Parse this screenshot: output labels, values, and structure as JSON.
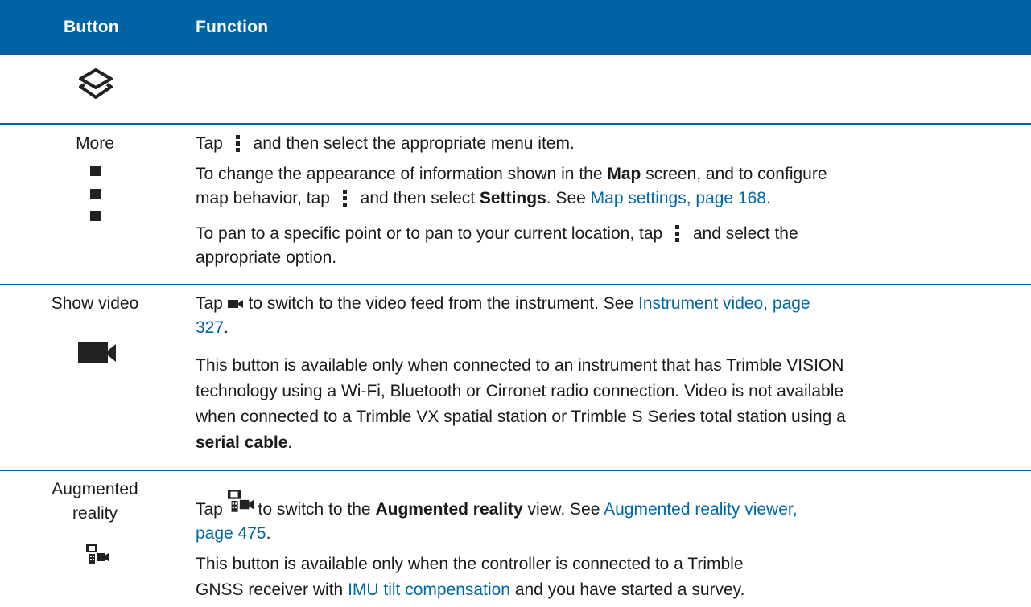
{
  "header": {
    "col_button": "Button",
    "col_function": "Function"
  },
  "icons": {
    "layers": "layers-icon",
    "more": "more-vertical-icon",
    "video": "video-camera-icon",
    "ar": "augmented-reality-icon"
  },
  "rows": {
    "more": {
      "label": "More",
      "p1_a": "Tap",
      "p1_b": "and then select the appropriate menu item.",
      "p2_a": "To change the appearance of information shown in the",
      "p2_map": "Map",
      "p2_b": "screen, and to configure",
      "p2_c": "map behavior, tap",
      "p2_d": "and then select",
      "p2_settings": "Settings",
      "p2_see": ". See",
      "p2_link": "Map settings, page 168",
      "p2_end": ".",
      "p3_a": "To pan to a specific point or to pan to your current location, tap",
      "p3_b": "and select the",
      "p3_c": "appropriate option."
    },
    "video": {
      "label": "Show video",
      "p1_a": "Tap",
      "p1_b": "to switch to the video feed from the instrument. See",
      "p1_link_a": "Instrument video, page",
      "p1_link_b": "327",
      "p1_end": ".",
      "p2_l1": "This button is available only when connected to an instrument that has Trimble VISION",
      "p2_l2": "technology using a Wi-Fi, Bluetooth or Cirronet radio connection. Video is not available",
      "p2_l3": "when connected to a Trimble VX spatial station or Trimble S Series total station using a",
      "p2_bold": "serial cable",
      "p2_end": "."
    },
    "ar": {
      "label_l1": "Augmented",
      "label_l2": "reality",
      "p1_a": "Tap",
      "p1_b": "to switch to the",
      "p1_bold": "Augmented reality",
      "p1_c": "view. See",
      "p1_link_a": "Augmented reality viewer,",
      "p1_link_b": "page 475",
      "p1_end": ".",
      "p2_l1": "This button is available only when the controller is connected to a Trimble",
      "p2_l2a": "GNSS receiver with",
      "p2_link": "IMU tilt compensation",
      "p2_l2b": "and you have started a survey."
    }
  }
}
